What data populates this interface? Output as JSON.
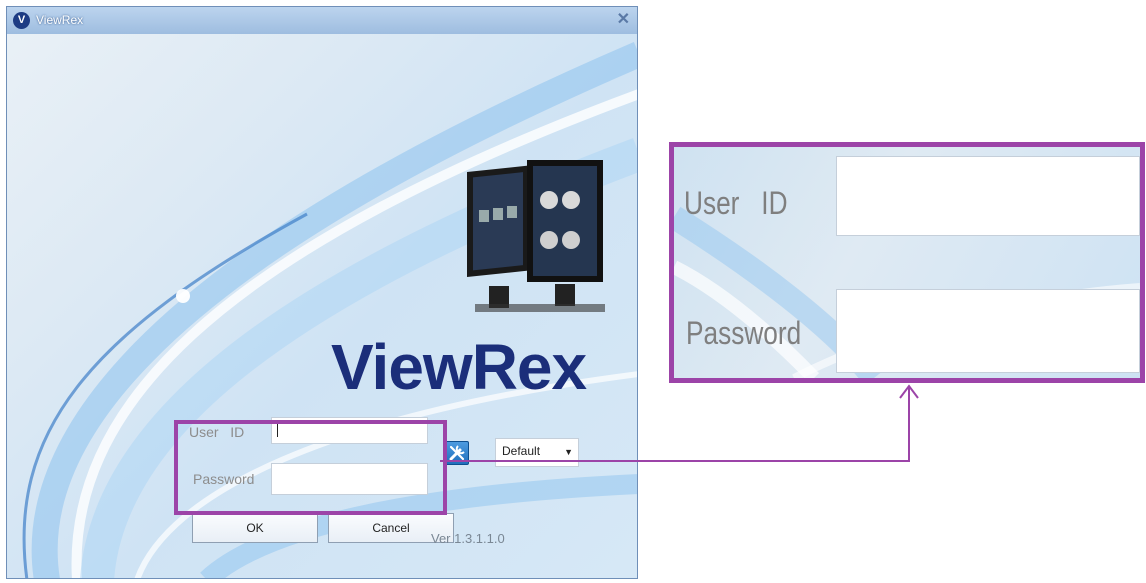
{
  "window": {
    "title": "ViewRex",
    "logo_letter": "V"
  },
  "brand": {
    "logo_text": "ViewRex"
  },
  "login": {
    "user_id_label": "User   ID",
    "user_id_value": "",
    "password_label": "Password",
    "password_value": "",
    "profile_select": "Default",
    "ok_label": "OK",
    "cancel_label": "Cancel",
    "version": "Ver 1.3.1.1.0"
  },
  "zoom_panel": {
    "user_id_label": "User   ID",
    "password_label": "Password"
  },
  "colors": {
    "highlight": "#9c44a8",
    "brand_text": "#1b2e7a",
    "settings_button": "#1f6fbc"
  },
  "icons": {
    "close": "close-icon",
    "settings": "tools-icon",
    "dropdown": "chevron-down-icon"
  }
}
